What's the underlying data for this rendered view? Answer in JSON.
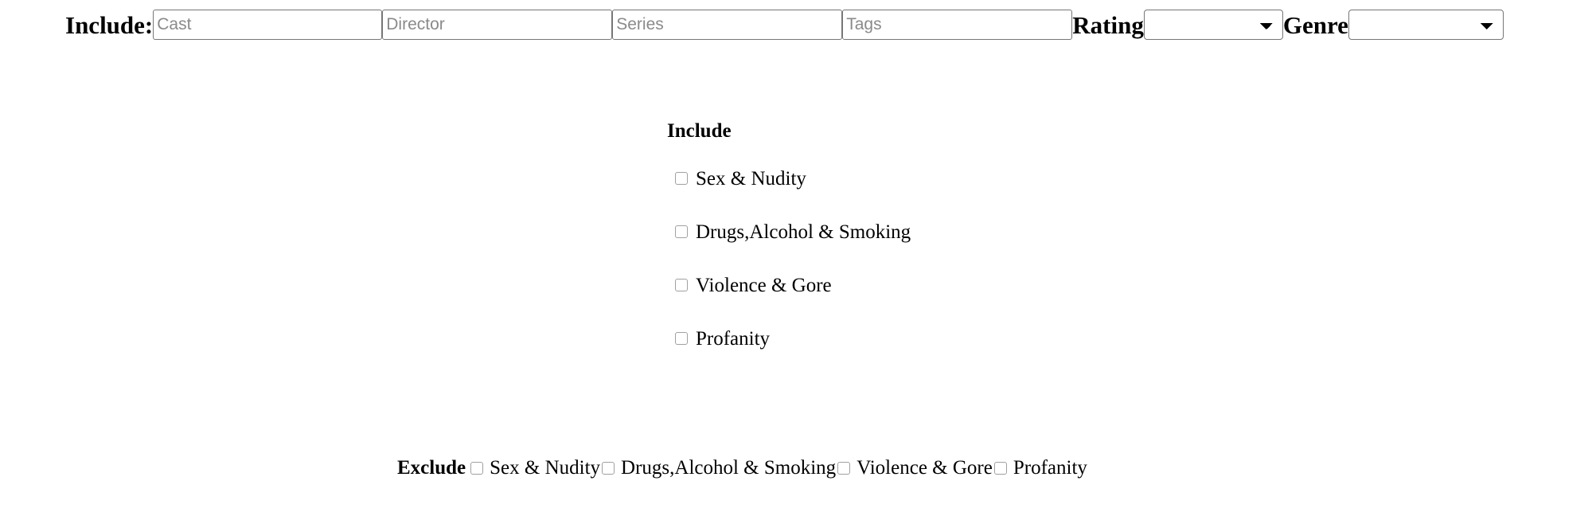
{
  "filter_bar": {
    "include_label": "Include:",
    "fields": [
      {
        "name": "cast",
        "placeholder": "Cast",
        "value": ""
      },
      {
        "name": "director",
        "placeholder": "Director",
        "value": ""
      },
      {
        "name": "series",
        "placeholder": "Series",
        "value": ""
      },
      {
        "name": "tags",
        "placeholder": "Tags",
        "value": ""
      }
    ],
    "rating": {
      "label": "Rating",
      "selected": "",
      "options": [
        ""
      ]
    },
    "genre": {
      "label": "Genre",
      "selected": "",
      "options": [
        ""
      ]
    }
  },
  "include_group": {
    "heading": "Include",
    "items": [
      {
        "label": "Sex & Nudity",
        "checked": false
      },
      {
        "label": "Drugs,Alcohol & Smoking",
        "checked": false
      },
      {
        "label": "Violence & Gore",
        "checked": false
      },
      {
        "label": "Profanity",
        "checked": false
      }
    ]
  },
  "exclude_group": {
    "heading": "Exclude",
    "items": [
      {
        "label": "Sex & Nudity",
        "checked": false
      },
      {
        "label": "Drugs,Alcohol & Smoking",
        "checked": false
      },
      {
        "label": "Violence & Gore",
        "checked": false
      },
      {
        "label": "Profanity",
        "checked": false
      }
    ]
  },
  "colors": {
    "background": "#ffffff",
    "text": "#000000",
    "placeholder": "#8a8a8a",
    "field_border": "#767676",
    "checkbox_border": "#a0a0a0"
  }
}
